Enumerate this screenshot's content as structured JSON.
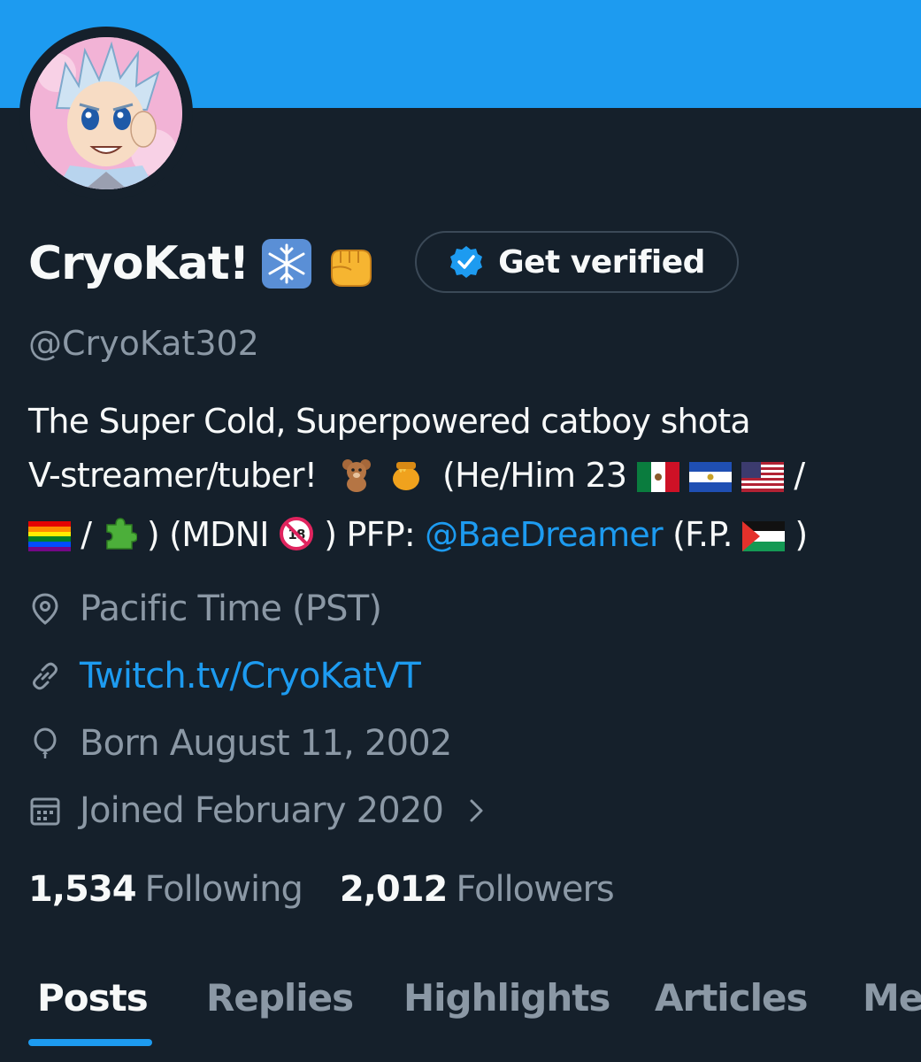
{
  "colors": {
    "banner": "#1d9bf0",
    "background": "#15202b",
    "accent": "#1d9bf0",
    "secondary_text": "#8b98a5"
  },
  "profile": {
    "display_name": "CryoKat!",
    "name_emojis": [
      "snowflake-emoji",
      "fist-emoji"
    ],
    "verify_button_label": "Get verified",
    "handle": "@CryoKat302",
    "bio": {
      "line1": "The Super Cold, Superpowered catboy shota",
      "line2_text": "V-streamer/tuber!",
      "line2_paren": "(He/Him 23",
      "line2_end": "/",
      "line3_slash": "/",
      "line3_mdni": ") (MDNI",
      "line3_pfp": ") PFP:",
      "line3_mention": "@BaeDreamer",
      "line3_fp": "(F.P.",
      "line3_close": ")"
    },
    "location": "Pacific Time (PST)",
    "website": "Twitch.tv/CryoKatVT",
    "birthday": "Born August 11, 2002",
    "joined": "Joined February 2020"
  },
  "stats": {
    "following_count": "1,534",
    "following_label": "Following",
    "followers_count": "2,012",
    "followers_label": "Followers"
  },
  "tabs": [
    {
      "label": "Posts",
      "active": true
    },
    {
      "label": "Replies",
      "active": false
    },
    {
      "label": "Highlights",
      "active": false
    },
    {
      "label": "Articles",
      "active": false
    },
    {
      "label": "Me",
      "active": false
    }
  ]
}
